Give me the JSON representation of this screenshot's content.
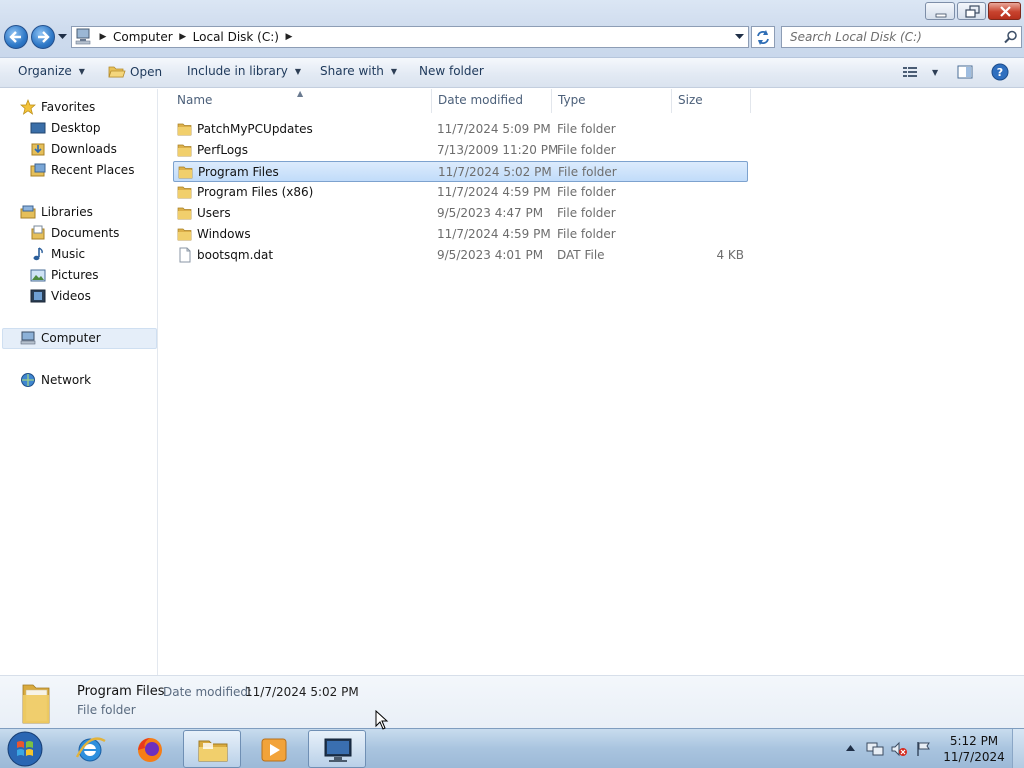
{
  "window": {
    "breadcrumbs": [
      "Computer",
      "Local Disk (C:)"
    ],
    "search_placeholder": "Search Local Disk (C:)"
  },
  "toolbar": {
    "organize": "Organize",
    "open": "Open",
    "include_in_library": "Include in library",
    "share_with": "Share with",
    "new_folder": "New folder"
  },
  "nav": {
    "favorites": "Favorites",
    "desktop": "Desktop",
    "downloads": "Downloads",
    "recent_places": "Recent Places",
    "libraries": "Libraries",
    "documents": "Documents",
    "music": "Music",
    "pictures": "Pictures",
    "videos": "Videos",
    "computer": "Computer",
    "network": "Network"
  },
  "columns": {
    "name": "Name",
    "date_modified": "Date modified",
    "type": "Type",
    "size": "Size"
  },
  "files": [
    {
      "name": "PatchMyPCUpdates",
      "date": "11/7/2024 5:09 PM",
      "type": "File folder",
      "size": "",
      "icon": "folder-icon"
    },
    {
      "name": "PerfLogs",
      "date": "7/13/2009 11:20 PM",
      "type": "File folder",
      "size": "",
      "icon": "folder-icon"
    },
    {
      "name": "Program Files",
      "date": "11/7/2024 5:02 PM",
      "type": "File folder",
      "size": "",
      "icon": "folder-icon",
      "selected": true
    },
    {
      "name": "Program Files (x86)",
      "date": "11/7/2024 4:59 PM",
      "type": "File folder",
      "size": "",
      "icon": "folder-icon"
    },
    {
      "name": "Users",
      "date": "9/5/2023 4:47 PM",
      "type": "File folder",
      "size": "",
      "icon": "folder-icon"
    },
    {
      "name": "Windows",
      "date": "11/7/2024 4:59 PM",
      "type": "File folder",
      "size": "",
      "icon": "folder-icon"
    },
    {
      "name": "bootsqm.dat",
      "date": "9/5/2023 4:01 PM",
      "type": "DAT File",
      "size": "4 KB",
      "icon": "file-icon"
    }
  ],
  "details": {
    "name": "Program Files",
    "date_label": "Date modified:",
    "date_value": "11/7/2024 5:02 PM",
    "type": "File folder"
  },
  "taskbar": {
    "time": "5:12 PM",
    "date": "11/7/2024"
  },
  "colors": {
    "selection": "#cce4fc",
    "taskbar": "#a9c4df",
    "folder": "#e8c25a"
  }
}
